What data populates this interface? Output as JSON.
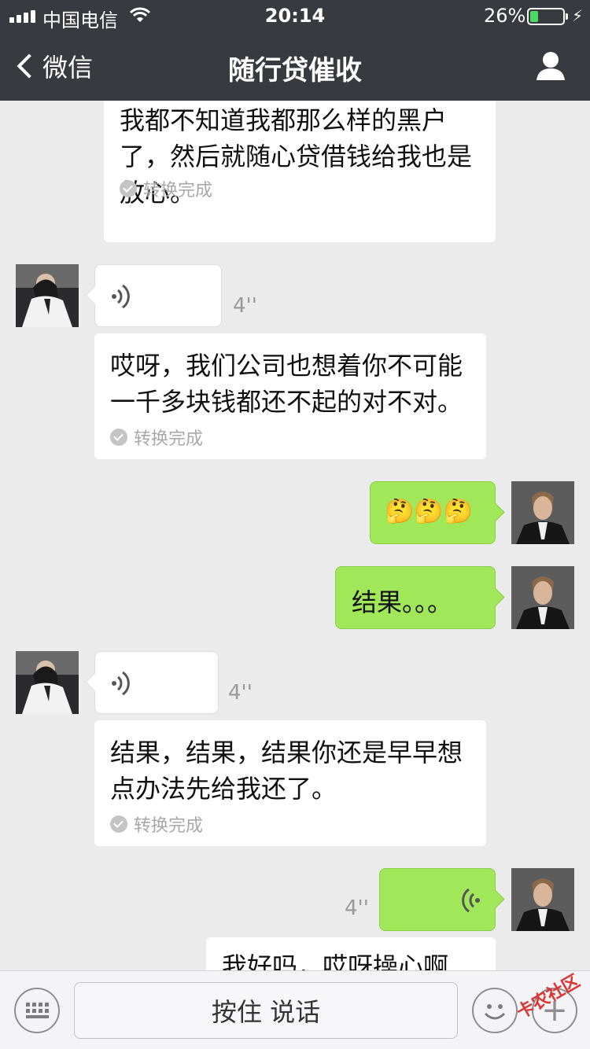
{
  "status_bar": {
    "carrier": "中国电信",
    "time": "20:14",
    "battery": "26%",
    "battery_level": 0.26
  },
  "nav": {
    "back_label": "微信",
    "title": "随行贷催收"
  },
  "messages": [
    {
      "type": "voice-transcript",
      "side": "left",
      "transcript": "我都不知道我都那么样的黑户了，然后就随心贷借钱给我也是放心。",
      "status": "转换完成"
    },
    {
      "type": "voice",
      "side": "left",
      "duration": "4''"
    },
    {
      "type": "voice-transcript",
      "side": "left",
      "transcript": "哎呀，我们公司也想着你不可能一千多块钱都还不起的对不对。",
      "status": "转换完成"
    },
    {
      "type": "emoji",
      "side": "right",
      "emoji": "🤔🤔🤔"
    },
    {
      "type": "text",
      "side": "right",
      "text": "结果。。。"
    },
    {
      "type": "voice",
      "side": "left",
      "duration": "4''"
    },
    {
      "type": "voice-transcript",
      "side": "left",
      "transcript": "结果，结果，结果你还是早早想点办法先给我还了。",
      "status": "转换完成"
    },
    {
      "type": "voice",
      "side": "right",
      "duration": "4''"
    },
    {
      "type": "voice-transcript",
      "side": "right",
      "transcript": "我好吗，哎呀操心啊"
    }
  ],
  "input_bar": {
    "hold_to_talk": "按住 说话"
  },
  "watermark": "卡农社区"
}
